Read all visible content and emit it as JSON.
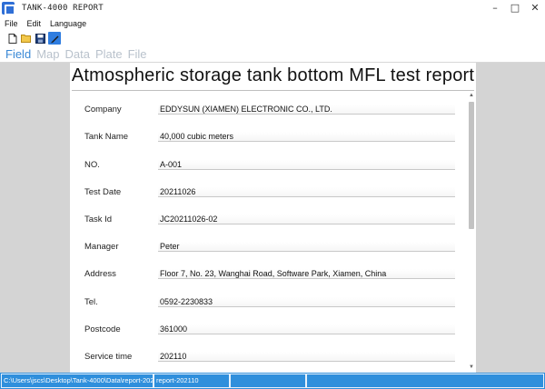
{
  "window": {
    "title": "TANK-4000 REPORT",
    "minimize": "–",
    "maximize": "□",
    "close": "✕"
  },
  "menu": [
    "File",
    "Edit",
    "Language"
  ],
  "toolbar": {
    "icons": [
      "new-file-icon",
      "open-folder-icon",
      "save-icon",
      "edit-pen-icon"
    ],
    "active_index": 3
  },
  "tabs": [
    {
      "label": "Field",
      "active": true
    },
    {
      "label": "Map",
      "active": false
    },
    {
      "label": "Data",
      "active": false
    },
    {
      "label": "Plate",
      "active": false
    },
    {
      "label": "File",
      "active": false
    }
  ],
  "report": {
    "title": "Atmospheric storage tank bottom MFL test report",
    "fields": [
      {
        "label": "Company",
        "value": "EDDYSUN (XIAMEN) ELECTRONIC CO., LTD."
      },
      {
        "label": "Tank Name",
        "value": "40,000 cubic meters"
      },
      {
        "label": "NO.",
        "value": "A-001"
      },
      {
        "label": "Test Date",
        "value": "20211026"
      },
      {
        "label": "Task Id",
        "value": "JC20211026-02"
      },
      {
        "label": "Manager",
        "value": "Peter"
      },
      {
        "label": "Address",
        "value": " Floor 7, No. 23, Wanghai Road, Software Park, Xiamen, China"
      },
      {
        "label": "Tel.",
        "value": "0592-2230833"
      },
      {
        "label": "Postcode",
        "value": "361000"
      },
      {
        "label": "Service time",
        "value": "202110"
      }
    ]
  },
  "status": {
    "path": "C:\\Users\\jscs\\Desktop\\Tank-4000\\Data\\report-202",
    "file": "report-202110",
    "extra": "",
    "extra2": ""
  },
  "colors": {
    "accent": "#2f8fdc",
    "tab_active": "#3a89d6",
    "tab_inactive": "#b9c2cc"
  }
}
